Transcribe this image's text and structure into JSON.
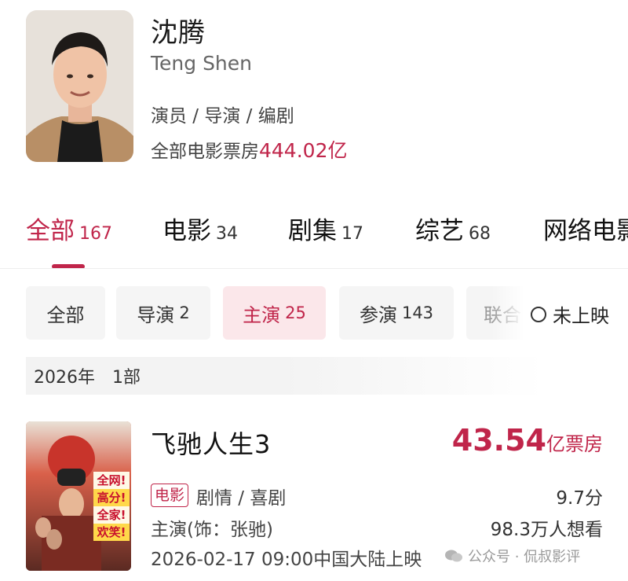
{
  "person": {
    "name": "沈腾",
    "name_en": "Teng Shen",
    "roles": "演员 / 导演 / 编剧",
    "boxoffice_label": "全部电影票房",
    "boxoffice_value": "444.02亿"
  },
  "tabs": [
    {
      "label": "全部",
      "count": "167",
      "active": true
    },
    {
      "label": "电影",
      "count": "34",
      "active": false
    },
    {
      "label": "剧集",
      "count": "17",
      "active": false
    },
    {
      "label": "综艺",
      "count": "68",
      "active": false
    },
    {
      "label": "网络电影",
      "count": "",
      "active": false
    }
  ],
  "filters": [
    {
      "label": "全部",
      "count": "",
      "active": false
    },
    {
      "label": "导演",
      "count": "2",
      "active": false
    },
    {
      "label": "主演",
      "count": "25",
      "active": true
    },
    {
      "label": "参演",
      "count": "143",
      "active": false
    },
    {
      "label": "联合",
      "count": "",
      "active": false
    }
  ],
  "unreleased_label": "未上映",
  "year_group": {
    "year": "2026年",
    "count": "1部"
  },
  "movie": {
    "title": "飞驰人生3",
    "boxoffice_num": "43.54",
    "boxoffice_unit": "亿票房",
    "type_tag": "电影",
    "genre": "剧情 / 喜剧",
    "score": "9.7分",
    "lead": "主演(饰：张驰)",
    "want": "98.3万人想看",
    "release": "2026-02-17 09:00中国大陆上映",
    "poster_texts": [
      "全网!",
      "高分!",
      "全家!",
      "欢笑!"
    ]
  },
  "watermark": "公众号 · 侃叔影评",
  "colors": {
    "accent": "#c0254a",
    "chip_bg": "#f5f5f5",
    "chip_active_bg": "#fbe7ea"
  }
}
